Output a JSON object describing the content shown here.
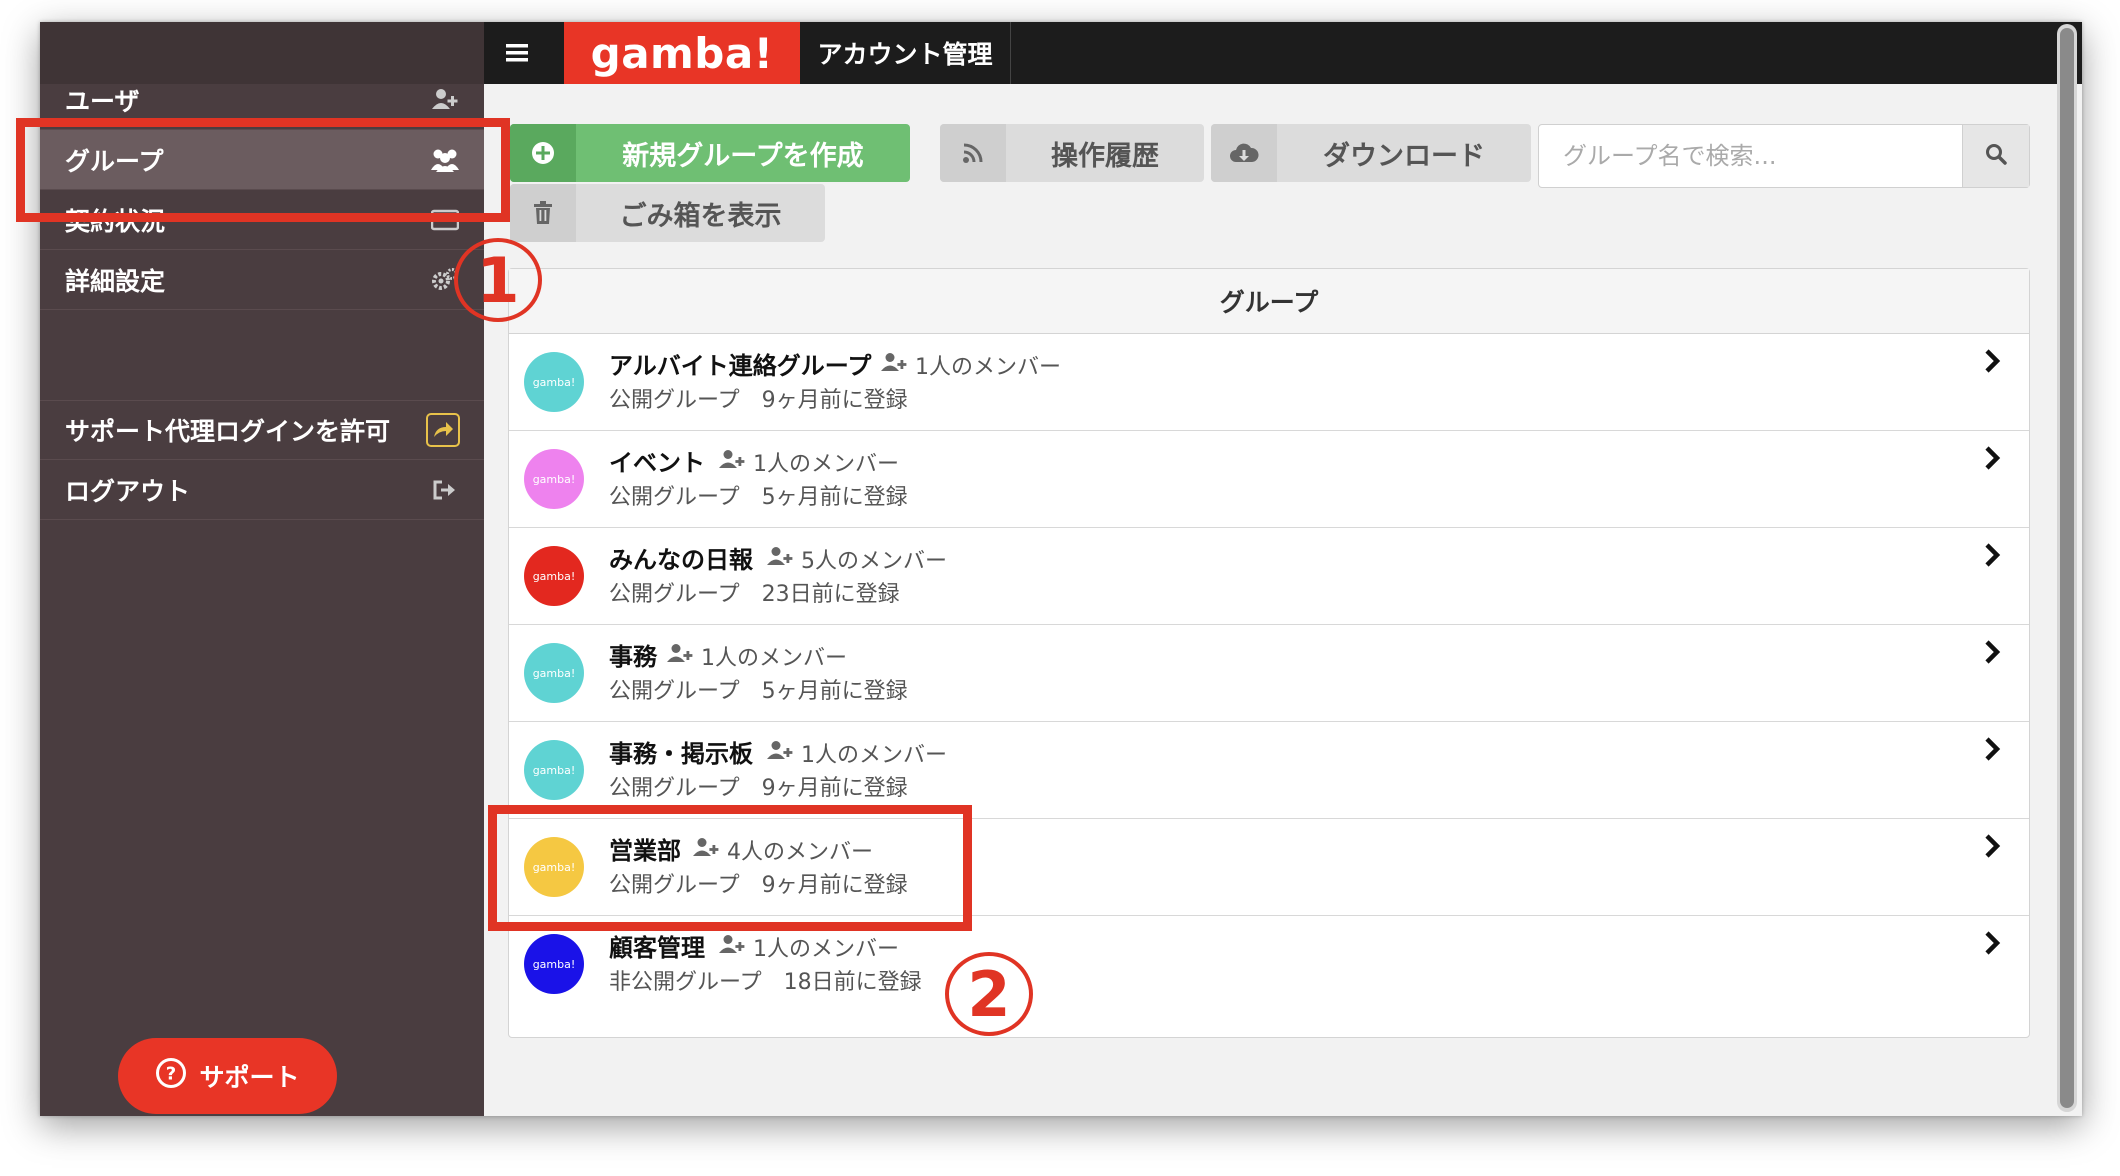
{
  "header": {
    "menu_icon": "hamburger-icon",
    "logo": "gamba!",
    "page_title": "アカウント管理"
  },
  "sidebar": {
    "items": [
      {
        "label": "ユーザ",
        "icon": "user-plus-icon"
      },
      {
        "label": "グループ",
        "icon": "users-icon",
        "active": true
      },
      {
        "label": "契約状況",
        "icon": "credit-card-icon"
      },
      {
        "label": "詳細設定",
        "icon": "gears-icon"
      },
      {
        "label": "サポート代理ログインを許可",
        "icon": "share-icon"
      },
      {
        "label": "ログアウト",
        "icon": "sign-out-icon"
      }
    ],
    "support_button": "サポート"
  },
  "toolbar": {
    "new_group": "新規グループを作成",
    "history": "操作履歴",
    "download": "ダウンロード",
    "trash": "ごみ箱を表示",
    "search_placeholder": "グループ名で検索..."
  },
  "panel": {
    "title": "グループ",
    "groups": [
      {
        "name": "アルバイト連絡グループ",
        "members": "1人のメンバー",
        "sub": "公開グループ　9ヶ月前に登録",
        "color": "#5fd3d3",
        "avatar": "gamba!"
      },
      {
        "name": "イベント",
        "members": "1人のメンバー",
        "sub": "公開グループ　5ヶ月前に登録",
        "color": "#ee82ee",
        "avatar": "gamba!"
      },
      {
        "name": "みんなの日報",
        "members": "5人のメンバー",
        "sub": "公開グループ　23日前に登録",
        "color": "#e3281f",
        "avatar": "gamba!"
      },
      {
        "name": "事務",
        "members": "1人のメンバー",
        "sub": "公開グループ　5ヶ月前に登録",
        "color": "#5fd3d3",
        "avatar": "gamba!"
      },
      {
        "name": "事務・掲示板",
        "members": "1人のメンバー",
        "sub": "公開グループ　9ヶ月前に登録",
        "color": "#5fd3d3",
        "avatar": "gamba!"
      },
      {
        "name": "営業部",
        "members": "4人のメンバー",
        "sub": "公開グループ　9ヶ月前に登録",
        "color": "#f5c842",
        "avatar": "gamba!"
      },
      {
        "name": "顧客管理",
        "members": "1人のメンバー",
        "sub": "非公開グループ　18日前に登録",
        "color": "#1a12e8",
        "avatar": "gamba!"
      }
    ]
  },
  "annotations": {
    "step1": "1",
    "step2": "2",
    "color": "#e03424"
  }
}
